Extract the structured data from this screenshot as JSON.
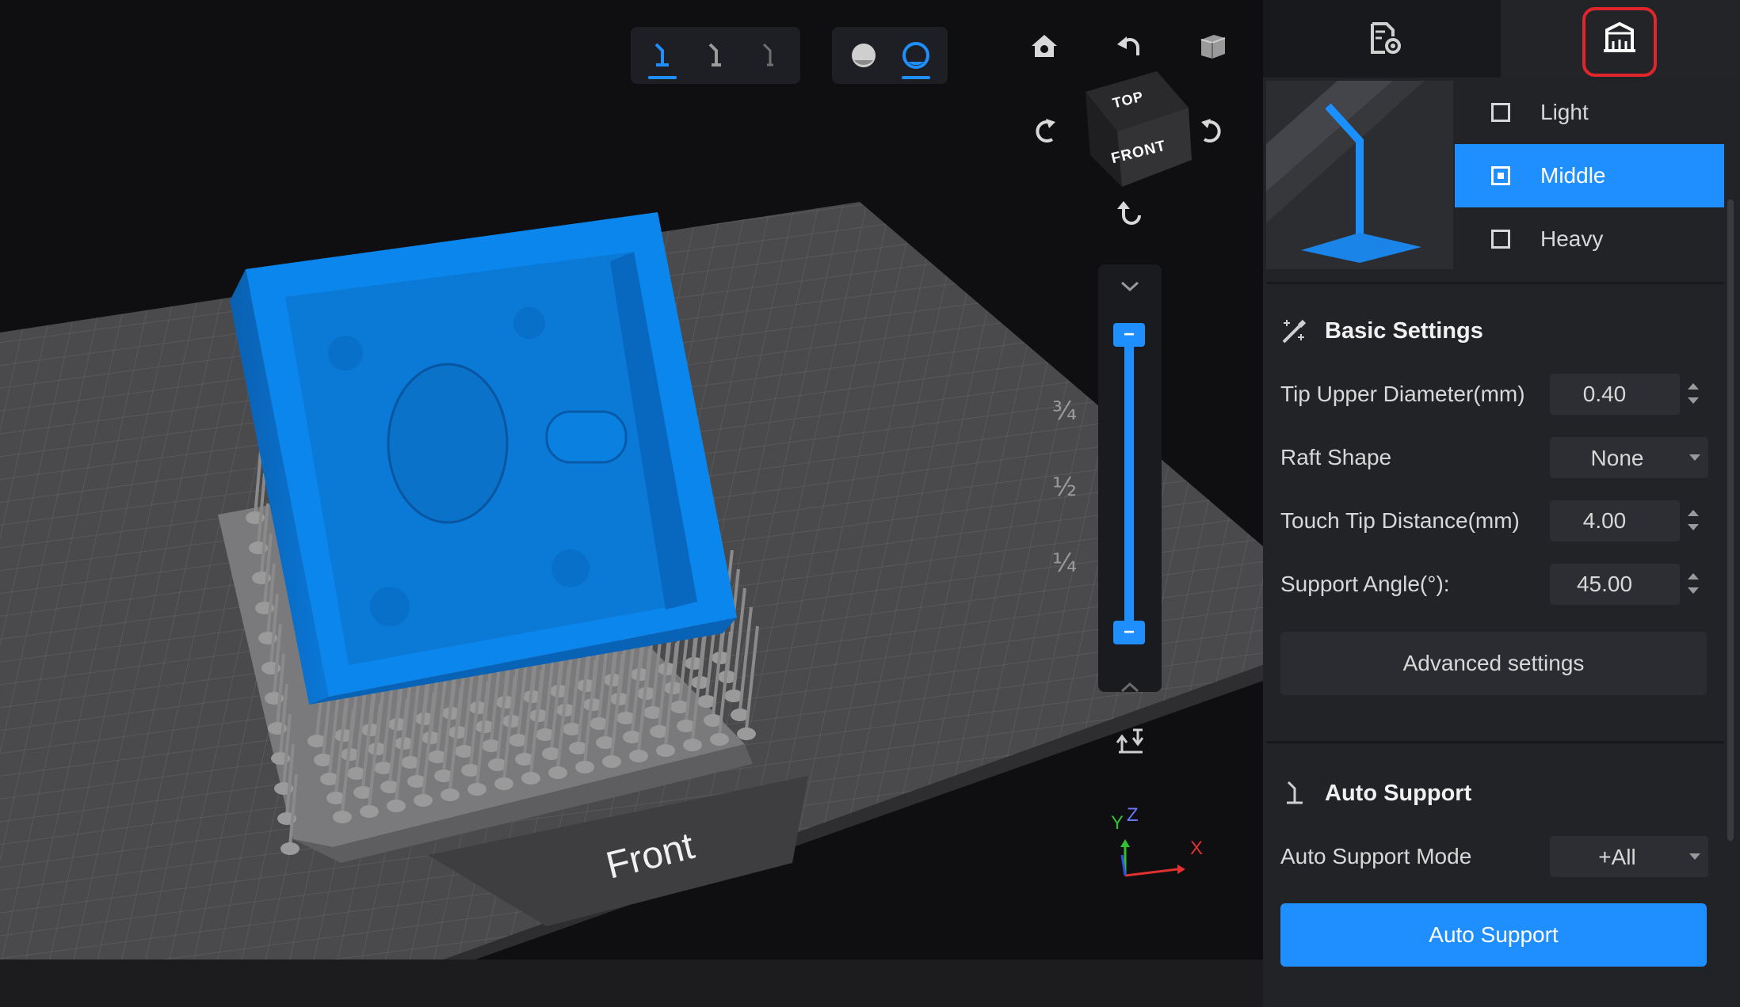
{
  "toolbar": {
    "support_tools": [
      "support-density-1-icon",
      "support-density-2-icon",
      "support-density-3-icon"
    ],
    "view_modes": [
      "solid-view-icon",
      "xray-view-icon"
    ],
    "camera": [
      "home-icon",
      "rotate-left-icon",
      "cube-view-icon",
      "rotate-ccw-icon",
      "rotate-cw-icon",
      "rotate-down-icon"
    ]
  },
  "view_cube": {
    "top": "TOP",
    "front": "FRONT"
  },
  "layer_slider": {
    "fractions": [
      "¾",
      "½",
      "¼"
    ],
    "handle_top": "−",
    "handle_bottom": "−",
    "upper_level": 0.98,
    "lower_level": 0.02
  },
  "scene": {
    "platform_label": "Front"
  },
  "axes": {
    "x": "X",
    "y": "Y",
    "z": "Z"
  },
  "panel": {
    "tabs": [
      "file-settings-icon",
      "support-panel-icon"
    ],
    "density": {
      "options": [
        {
          "label": "Light",
          "selected": false
        },
        {
          "label": "Middle",
          "selected": true
        },
        {
          "label": "Heavy",
          "selected": false
        }
      ]
    },
    "basic_settings": {
      "title": "Basic Settings",
      "rows": [
        {
          "label": "Tip Upper Diameter(mm)",
          "value": "0.40",
          "type": "number"
        },
        {
          "label": "Raft Shape",
          "value": "None",
          "type": "select"
        },
        {
          "label": "Touch Tip Distance(mm)",
          "value": "4.00",
          "type": "number"
        },
        {
          "label": "Support Angle(°):",
          "value": "45.00",
          "type": "number"
        }
      ],
      "advanced_label": "Advanced settings"
    },
    "auto_support": {
      "title": "Auto Support",
      "mode_label": "Auto Support Mode",
      "mode_value": "+All",
      "button_label": "Auto Support"
    }
  },
  "colors": {
    "accent": "#1f8fff",
    "model": "#0a84e8",
    "highlight": "#e0262b",
    "support": "#8a8a8a"
  }
}
